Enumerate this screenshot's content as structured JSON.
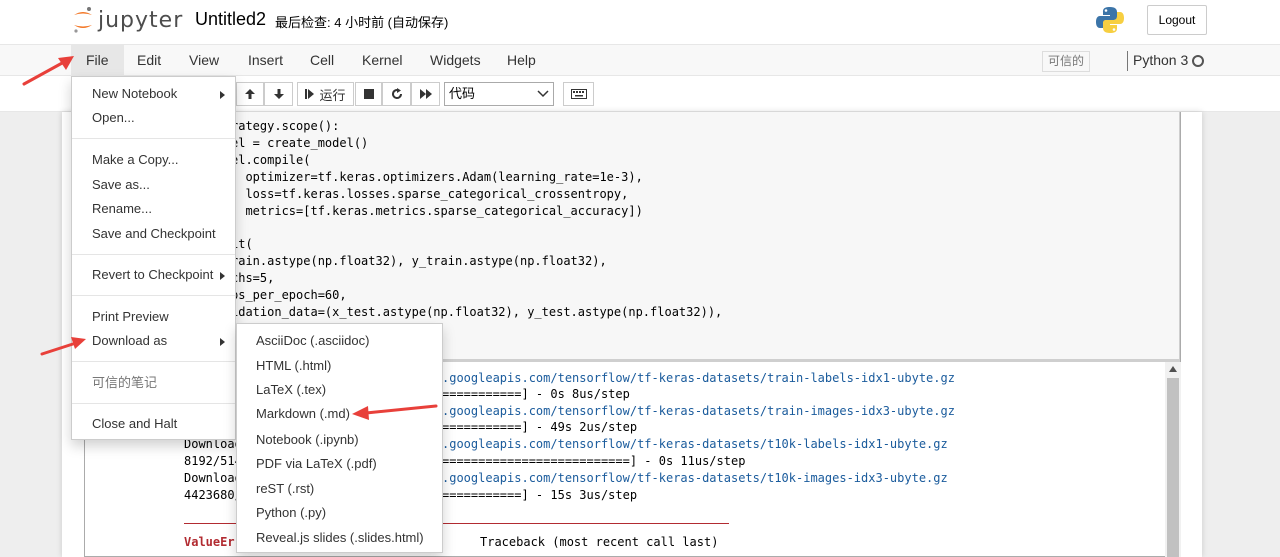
{
  "header": {
    "app_name": "jupyter",
    "notebook_name": "Untitled2",
    "checkpoint_status": "最后检查: 4 小时前  (自动保存)",
    "logout_label": "Logout"
  },
  "menubar": {
    "items": [
      "File",
      "Edit",
      "View",
      "Insert",
      "Cell",
      "Kernel",
      "Widgets",
      "Help"
    ],
    "trusted_label": "可信的",
    "kernel_name": "Python 3"
  },
  "toolbar": {
    "run_label": "运行",
    "cell_type": "代码"
  },
  "code_lines": [
    "rategy.scope():",
    "el = create_model()",
    "el.compile(",
    "  optimizer=tf.keras.optimizers.Adam(learning_rate=1e-3),",
    "  loss=tf.keras.losses.sparse_categorical_crossentropy,",
    "  metrics=[tf.keras.metrics.sparse_categorical_accuracy])",
    "",
    "it(",
    "rain.astype(np.float32), y_train.astype(np.float32),",
    "chs=5,",
    "ps_per_epoch=60,",
    "idation_data=(x_test.astype(np.float32), y_test.astype(np.float32)),"
  ],
  "output": {
    "left_fragments": [
      "Download",
      "8192/514",
      "Download",
      "4423680/"
    ],
    "right_lines": [
      ".googleapis.com/tensorflow/tf-keras-datasets/train-labels-idx1-ubyte.gz",
      "===========] - 0s 8us/step",
      ".googleapis.com/tensorflow/tf-keras-datasets/train-images-idx3-ubyte.gz",
      "===========] - 49s 2us/step",
      ".googleapis.com/tensorflow/tf-keras-datasets/t10k-labels-idx1-ubyte.gz",
      "==========================] - 0s 11us/step",
      ".googleapis.com/tensorflow/tf-keras-datasets/t10k-images-idx3-ubyte.gz",
      "===========] - 15s 3us/step"
    ],
    "error_name": "ValueErr",
    "traceback_label": "Traceback (most recent call last)"
  },
  "file_menu": {
    "new_notebook": "New Notebook",
    "open": "Open...",
    "make_copy": "Make a Copy...",
    "save_as": "Save as...",
    "rename": "Rename...",
    "save_checkpoint": "Save and Checkpoint",
    "revert": "Revert to Checkpoint",
    "print_preview": "Print Preview",
    "download_as": "Download as",
    "trusted_notebook": "可信的笔记",
    "close_halt": "Close and Halt"
  },
  "download_menu": {
    "items": [
      "AsciiDoc (.asciidoc)",
      "HTML (.html)",
      "LaTeX (.tex)",
      "Markdown (.md)",
      "Notebook (.ipynb)",
      "PDF via LaTeX (.pdf)",
      "reST (.rst)",
      "Python (.py)",
      "Reveal.js slides (.slides.html)"
    ]
  },
  "colors": {
    "annotation_arrow": "#e8403a",
    "link": "#1a5b9c",
    "error": "#b22b31",
    "keyword": "#008000"
  }
}
